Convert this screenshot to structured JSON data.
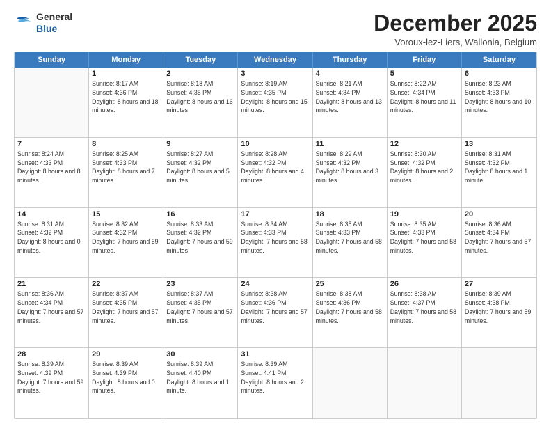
{
  "logo": {
    "line1": "General",
    "line2": "Blue"
  },
  "title": "December 2025",
  "location": "Voroux-lez-Liers, Wallonia, Belgium",
  "header": {
    "days": [
      "Sunday",
      "Monday",
      "Tuesday",
      "Wednesday",
      "Thursday",
      "Friday",
      "Saturday"
    ]
  },
  "weeks": [
    [
      {
        "day": "",
        "sunrise": "",
        "sunset": "",
        "daylight": ""
      },
      {
        "day": "1",
        "sunrise": "Sunrise: 8:17 AM",
        "sunset": "Sunset: 4:36 PM",
        "daylight": "Daylight: 8 hours and 18 minutes."
      },
      {
        "day": "2",
        "sunrise": "Sunrise: 8:18 AM",
        "sunset": "Sunset: 4:35 PM",
        "daylight": "Daylight: 8 hours and 16 minutes."
      },
      {
        "day": "3",
        "sunrise": "Sunrise: 8:19 AM",
        "sunset": "Sunset: 4:35 PM",
        "daylight": "Daylight: 8 hours and 15 minutes."
      },
      {
        "day": "4",
        "sunrise": "Sunrise: 8:21 AM",
        "sunset": "Sunset: 4:34 PM",
        "daylight": "Daylight: 8 hours and 13 minutes."
      },
      {
        "day": "5",
        "sunrise": "Sunrise: 8:22 AM",
        "sunset": "Sunset: 4:34 PM",
        "daylight": "Daylight: 8 hours and 11 minutes."
      },
      {
        "day": "6",
        "sunrise": "Sunrise: 8:23 AM",
        "sunset": "Sunset: 4:33 PM",
        "daylight": "Daylight: 8 hours and 10 minutes."
      }
    ],
    [
      {
        "day": "7",
        "sunrise": "Sunrise: 8:24 AM",
        "sunset": "Sunset: 4:33 PM",
        "daylight": "Daylight: 8 hours and 8 minutes."
      },
      {
        "day": "8",
        "sunrise": "Sunrise: 8:25 AM",
        "sunset": "Sunset: 4:33 PM",
        "daylight": "Daylight: 8 hours and 7 minutes."
      },
      {
        "day": "9",
        "sunrise": "Sunrise: 8:27 AM",
        "sunset": "Sunset: 4:32 PM",
        "daylight": "Daylight: 8 hours and 5 minutes."
      },
      {
        "day": "10",
        "sunrise": "Sunrise: 8:28 AM",
        "sunset": "Sunset: 4:32 PM",
        "daylight": "Daylight: 8 hours and 4 minutes."
      },
      {
        "day": "11",
        "sunrise": "Sunrise: 8:29 AM",
        "sunset": "Sunset: 4:32 PM",
        "daylight": "Daylight: 8 hours and 3 minutes."
      },
      {
        "day": "12",
        "sunrise": "Sunrise: 8:30 AM",
        "sunset": "Sunset: 4:32 PM",
        "daylight": "Daylight: 8 hours and 2 minutes."
      },
      {
        "day": "13",
        "sunrise": "Sunrise: 8:31 AM",
        "sunset": "Sunset: 4:32 PM",
        "daylight": "Daylight: 8 hours and 1 minute."
      }
    ],
    [
      {
        "day": "14",
        "sunrise": "Sunrise: 8:31 AM",
        "sunset": "Sunset: 4:32 PM",
        "daylight": "Daylight: 8 hours and 0 minutes."
      },
      {
        "day": "15",
        "sunrise": "Sunrise: 8:32 AM",
        "sunset": "Sunset: 4:32 PM",
        "daylight": "Daylight: 7 hours and 59 minutes."
      },
      {
        "day": "16",
        "sunrise": "Sunrise: 8:33 AM",
        "sunset": "Sunset: 4:32 PM",
        "daylight": "Daylight: 7 hours and 59 minutes."
      },
      {
        "day": "17",
        "sunrise": "Sunrise: 8:34 AM",
        "sunset": "Sunset: 4:33 PM",
        "daylight": "Daylight: 7 hours and 58 minutes."
      },
      {
        "day": "18",
        "sunrise": "Sunrise: 8:35 AM",
        "sunset": "Sunset: 4:33 PM",
        "daylight": "Daylight: 7 hours and 58 minutes."
      },
      {
        "day": "19",
        "sunrise": "Sunrise: 8:35 AM",
        "sunset": "Sunset: 4:33 PM",
        "daylight": "Daylight: 7 hours and 58 minutes."
      },
      {
        "day": "20",
        "sunrise": "Sunrise: 8:36 AM",
        "sunset": "Sunset: 4:34 PM",
        "daylight": "Daylight: 7 hours and 57 minutes."
      }
    ],
    [
      {
        "day": "21",
        "sunrise": "Sunrise: 8:36 AM",
        "sunset": "Sunset: 4:34 PM",
        "daylight": "Daylight: 7 hours and 57 minutes."
      },
      {
        "day": "22",
        "sunrise": "Sunrise: 8:37 AM",
        "sunset": "Sunset: 4:35 PM",
        "daylight": "Daylight: 7 hours and 57 minutes."
      },
      {
        "day": "23",
        "sunrise": "Sunrise: 8:37 AM",
        "sunset": "Sunset: 4:35 PM",
        "daylight": "Daylight: 7 hours and 57 minutes."
      },
      {
        "day": "24",
        "sunrise": "Sunrise: 8:38 AM",
        "sunset": "Sunset: 4:36 PM",
        "daylight": "Daylight: 7 hours and 57 minutes."
      },
      {
        "day": "25",
        "sunrise": "Sunrise: 8:38 AM",
        "sunset": "Sunset: 4:36 PM",
        "daylight": "Daylight: 7 hours and 58 minutes."
      },
      {
        "day": "26",
        "sunrise": "Sunrise: 8:38 AM",
        "sunset": "Sunset: 4:37 PM",
        "daylight": "Daylight: 7 hours and 58 minutes."
      },
      {
        "day": "27",
        "sunrise": "Sunrise: 8:39 AM",
        "sunset": "Sunset: 4:38 PM",
        "daylight": "Daylight: 7 hours and 59 minutes."
      }
    ],
    [
      {
        "day": "28",
        "sunrise": "Sunrise: 8:39 AM",
        "sunset": "Sunset: 4:39 PM",
        "daylight": "Daylight: 7 hours and 59 minutes."
      },
      {
        "day": "29",
        "sunrise": "Sunrise: 8:39 AM",
        "sunset": "Sunset: 4:39 PM",
        "daylight": "Daylight: 8 hours and 0 minutes."
      },
      {
        "day": "30",
        "sunrise": "Sunrise: 8:39 AM",
        "sunset": "Sunset: 4:40 PM",
        "daylight": "Daylight: 8 hours and 1 minute."
      },
      {
        "day": "31",
        "sunrise": "Sunrise: 8:39 AM",
        "sunset": "Sunset: 4:41 PM",
        "daylight": "Daylight: 8 hours and 2 minutes."
      },
      {
        "day": "",
        "sunrise": "",
        "sunset": "",
        "daylight": ""
      },
      {
        "day": "",
        "sunrise": "",
        "sunset": "",
        "daylight": ""
      },
      {
        "day": "",
        "sunrise": "",
        "sunset": "",
        "daylight": ""
      }
    ]
  ]
}
